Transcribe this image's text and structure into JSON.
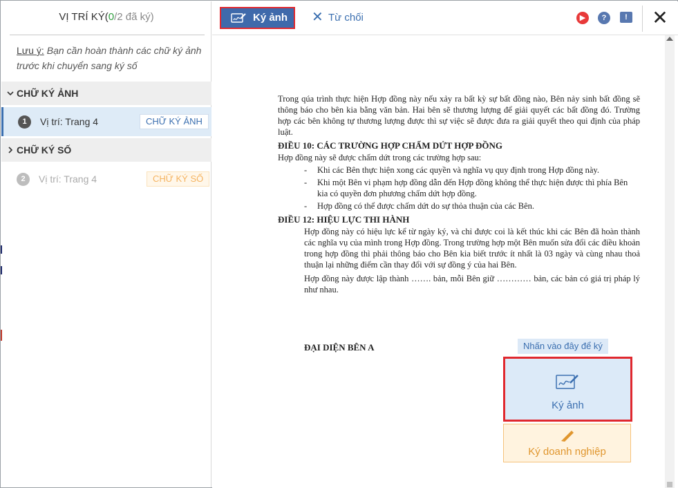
{
  "sidebar": {
    "title_prefix": "VỊ TRÍ KÝ(",
    "signed_count": "0",
    "title_suffix": "/2 đã ký)",
    "notice_label": "Lưu ý:",
    "notice_text": "Bạn cần hoàn thành các chữ ký ảnh trước khi chuyển sang ký số",
    "groups": [
      {
        "label": "CHỮ KÝ ẢNH",
        "chevron": "›",
        "items": [
          {
            "number": "1",
            "location": "Vị trí: Trang 4",
            "badge": "CHỮ KÝ ẢNH"
          }
        ]
      },
      {
        "label": "CHỮ KÝ SỐ",
        "chevron": "›",
        "items": [
          {
            "number": "2",
            "location": "Vị trí: Trang 4",
            "badge": "CHỮ KÝ SỐ"
          }
        ]
      }
    ]
  },
  "toolbar": {
    "sign_photo_label": "Ký ảnh",
    "reject_label": "Từ chối",
    "reject_glyph": "✕",
    "play_glyph": "▶",
    "help_glyph": "?",
    "feedback_glyph": "!",
    "close_glyph": "✕"
  },
  "document": {
    "para_intro": "Trong qúa trình thực hiện Hợp đồng này nếu xảy ra bất kỳ sự bất đồng nào, Bên nảy sinh bất đồng sẽ thông báo cho bên kia bằng văn bản. Hai bên sẽ thương lượng để giải quyết các bất đồng đó. Trường hợp các bên không tự thương lượng được thì sự việc sẽ được đưa ra giải quyết theo qui định của pháp luật.",
    "heading_10": "ĐIỀU 10: CÁC TRƯỜNG HỢP CHẤM DỨT HỢP ĐỒNG",
    "para_10": "Hợp đồng này sẽ được chấm dứt trong các trường hợp sau:",
    "dash": "-",
    "bullets": [
      "Khi các Bên thực hiện xong các quyền và nghĩa vụ quy định trong Hợp đồng này.",
      "Khi một Bên vi phạm hợp đồng dẫn đến Hợp đồng không thể thực hiện được thì phía Bên kia có quyền đơn phương chấm dứt hợp đồng.",
      "Hợp đồng có thể được chấm dứt do sự thỏa thuận của các Bên."
    ],
    "heading_12": "ĐIỀU 12: HIỆU LỰC THI HÀNH",
    "para_12a": "Hợp đồng này có hiệu lực kể từ ngày ký, và chỉ được coi là kết thúc khi các Bên đã hoàn thành các nghĩa vụ của mình trong Hợp đồng. Trong trường hợp một Bên muốn sửa đổi các điều khoản trong hợp đồng thì phải thông báo cho Bên kia biết trước ít nhất là 03 ngày và cùng nhau thoả thuận lại những điểm cần thay đổi với sự đồng ý của hai Bên.",
    "para_12b": "Hợp đồng này được lập thành ……. bản, mỗi Bên giữ ………… bản, các bản có giá trị pháp lý như nhau.",
    "representative": "ĐẠI DIỆN BÊN A"
  },
  "signature": {
    "hint": "Nhấn vào đây để ký",
    "photo_label": "Ký ảnh",
    "business_label": "Ký doanh nghiệp"
  },
  "colors": {
    "primary": "#3f6aab",
    "highlight_border": "#e0282e",
    "signed_count": "#2e9e3e",
    "digital_badge": "#f5b35f",
    "business_box": "#fff3df"
  },
  "icons": {
    "sign_photo": "signature-pen-icon",
    "reject": "close-icon",
    "play": "play-icon",
    "help": "help-icon",
    "feedback": "feedback-icon",
    "close": "close-icon",
    "business_pen": "pen-icon"
  }
}
